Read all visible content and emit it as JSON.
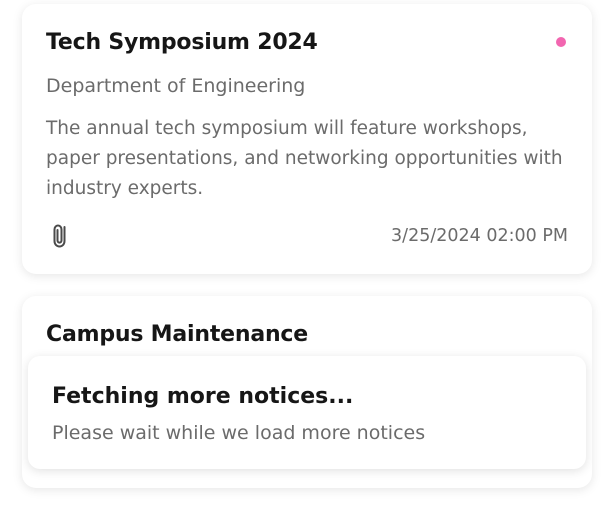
{
  "notices": [
    {
      "title": "Tech Symposium 2024",
      "department": "Department of Engineering",
      "body": "The annual tech symposium will feature workshops, paper presentations, and networking opportunities with industry experts.",
      "timestamp": "3/25/2024 02:00 PM",
      "unread_dot_color": "#f266b0",
      "attachment_icon": "paperclip-icon"
    },
    {
      "title": "Campus Maintenance"
    }
  ],
  "loading": {
    "title": "Fetching more notices...",
    "subtitle": "Please wait while we load more notices"
  },
  "colors": {
    "title_text": "#161616",
    "secondary_text": "#6b6b6b",
    "card_background": "#ffffff"
  }
}
